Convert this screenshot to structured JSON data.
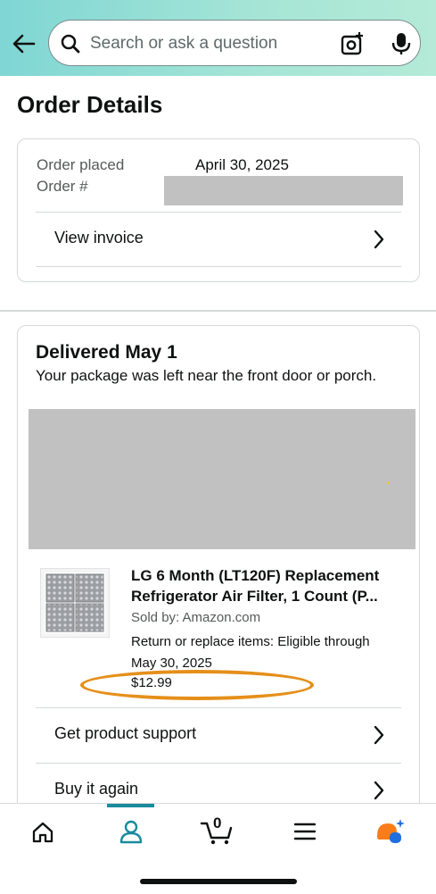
{
  "header": {
    "search_placeholder": "Search or ask a question"
  },
  "page_title": "Order Details",
  "order_summary": {
    "placed_label": "Order placed",
    "placed_value": "April 30, 2025",
    "number_label": "Order #",
    "view_invoice": "View invoice"
  },
  "delivery": {
    "status": "Delivered May 1",
    "note": "Your package was left near the front door or porch."
  },
  "product": {
    "title_line1": "LG 6 Month (LT120F) Replacement",
    "title_line2": "Refrigerator Air Filter, 1 Count (P...",
    "seller": "Sold by: Amazon.com",
    "return_line1": "Return or replace items: Eligible through",
    "return_line2": "May 30, 2025",
    "price": "$12.99"
  },
  "actions": {
    "support": "Get product support",
    "buy_again": "Buy it again"
  },
  "bottom_nav": {
    "cart_count": "0",
    "active_tab": "account",
    "accent_color": "#1a8b9d"
  },
  "colors": {
    "highlight_oval": "#e58f1a",
    "redaction": "#c1c1c1"
  }
}
